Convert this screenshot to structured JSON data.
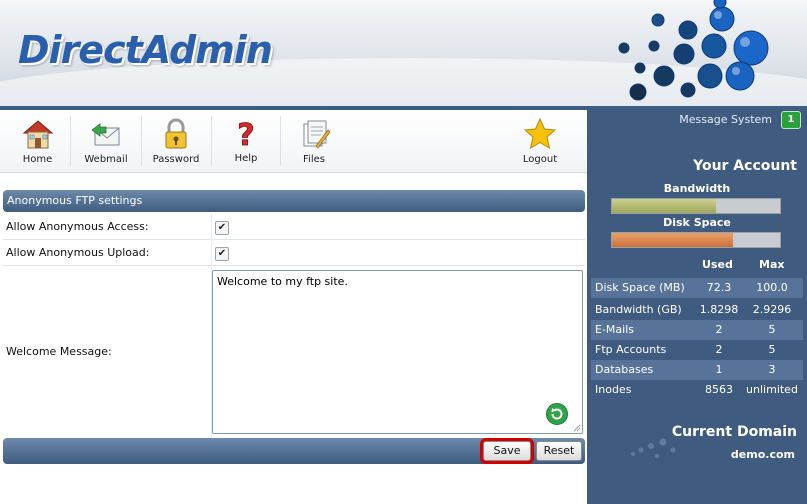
{
  "header": {
    "logo_text": "DirectAdmin"
  },
  "toolbar": {
    "items": [
      {
        "label": "Home"
      },
      {
        "label": "Webmail"
      },
      {
        "label": "Password"
      },
      {
        "label": "Help"
      },
      {
        "label": "Files"
      },
      {
        "label": "Logout"
      }
    ]
  },
  "ftp": {
    "title": "Anonymous FTP settings",
    "allow_access_label": "Allow Anonymous Access:",
    "allow_access_checked": true,
    "allow_upload_label": "Allow Anonymous Upload:",
    "allow_upload_checked": true,
    "welcome_label": "Welcome Message:",
    "welcome_value": "Welcome to my ftp site.",
    "save_label": "Save",
    "reset_label": "Reset"
  },
  "sidebar": {
    "message_system": "Message System",
    "message_count": "1",
    "your_account": "Your Account",
    "bandwidth_label": "Bandwidth",
    "bandwidth_fill": 0.62,
    "disk_label": "Disk Space",
    "disk_fill": 0.72,
    "col_used": "Used",
    "col_max": "Max",
    "stats": [
      {
        "name": "Disk Space (MB)",
        "used": "72.3",
        "max": "100.0"
      },
      {
        "name": "Bandwidth (GB)",
        "used": "1.8298",
        "max": "2.9296"
      },
      {
        "name": "E-Mails",
        "used": "2",
        "max": "5"
      },
      {
        "name": "Ftp Accounts",
        "used": "2",
        "max": "5"
      },
      {
        "name": "Databases",
        "used": "1",
        "max": "3"
      },
      {
        "name": "Inodes",
        "used": "8563",
        "max": "unlimited"
      }
    ],
    "current_domain_title": "Current Domain",
    "current_domain": "demo.com"
  },
  "colors": {
    "brand_blue": "#2a5fae",
    "sidebar_bg": "#3f5b7f",
    "panel_header": "#4d6b8f",
    "bandwidth_fill": "#a8b26a",
    "disk_fill": "#d98a4a",
    "highlight_red": "#d30000",
    "badge_green": "#28a23b"
  }
}
